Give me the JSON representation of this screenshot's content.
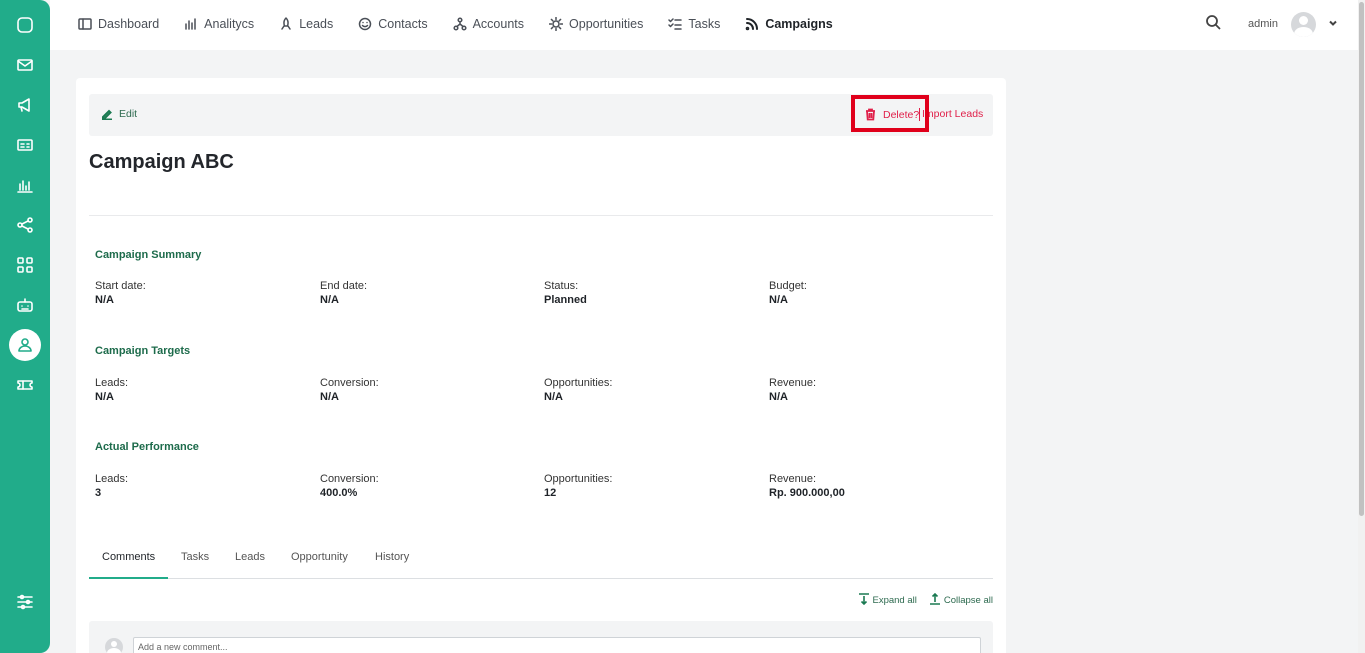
{
  "sidebar": {
    "icons": [
      "chat-icon",
      "mail-icon",
      "megaphone-icon",
      "id-card-icon",
      "bar-chart-icon",
      "share-icon",
      "grid-icon",
      "robot-icon",
      "user-icon",
      "ticket-icon",
      "sliders-icon"
    ],
    "active": "user-icon",
    "color": "#21ac8a"
  },
  "nav": {
    "items": [
      {
        "label": "Dashboard",
        "icon": "dashboard-icon"
      },
      {
        "label": "Analitycs",
        "icon": "analytics-icon"
      },
      {
        "label": "Leads",
        "icon": "rocket-icon"
      },
      {
        "label": "Contacts",
        "icon": "smiley-icon"
      },
      {
        "label": "Accounts",
        "icon": "network-icon"
      },
      {
        "label": "Opportunities",
        "icon": "sun-icon"
      },
      {
        "label": "Tasks",
        "icon": "checklist-icon"
      },
      {
        "label": "Campaigns",
        "icon": "rss-icon"
      }
    ],
    "active": "Campaigns"
  },
  "user": {
    "name": "admin"
  },
  "toolbar": {
    "edit_label": "Edit",
    "delete_label": "Delete?",
    "import_label": "Import Leads"
  },
  "campaign": {
    "title": "Campaign ABC"
  },
  "sections": {
    "summary": {
      "title": "Campaign Summary",
      "fields": [
        {
          "label": "Start date:",
          "value": "N/A"
        },
        {
          "label": "End date:",
          "value": "N/A"
        },
        {
          "label": "Status:",
          "value": "Planned"
        },
        {
          "label": "Budget:",
          "value": "N/A"
        }
      ]
    },
    "targets": {
      "title": "Campaign Targets",
      "fields": [
        {
          "label": "Leads:",
          "value": "N/A"
        },
        {
          "label": "Conversion:",
          "value": "N/A"
        },
        {
          "label": "Opportunities:",
          "value": "N/A"
        },
        {
          "label": "Revenue:",
          "value": "N/A"
        }
      ]
    },
    "actual": {
      "title": "Actual Performance",
      "fields": [
        {
          "label": "Leads:",
          "value": "3"
        },
        {
          "label": "Conversion:",
          "value": "400.0%"
        },
        {
          "label": "Opportunities:",
          "value": "12"
        },
        {
          "label": "Revenue:",
          "value": "Rp. 900.000,00"
        }
      ]
    }
  },
  "tabs": [
    {
      "label": "Comments"
    },
    {
      "label": "Tasks"
    },
    {
      "label": "Leads"
    },
    {
      "label": "Opportunity"
    },
    {
      "label": "History"
    }
  ],
  "active_tab": "Comments",
  "comments": {
    "expand_label": "Expand all",
    "collapse_label": "Collapse all",
    "placeholder": "Add a new comment..."
  }
}
